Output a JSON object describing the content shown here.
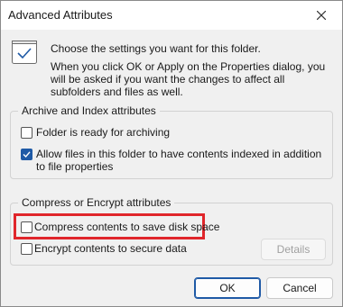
{
  "window": {
    "title": "Advanced Attributes"
  },
  "header": {
    "line1": "Choose the settings you want for this folder.",
    "line2": "When you click OK or Apply on the Properties dialog, you will be asked if you want the changes to affect all subfolders and files as well.",
    "icon": "folder-settings-icon"
  },
  "archive_group": {
    "title": "Archive and Index attributes",
    "options": [
      {
        "label": "Folder is ready for archiving",
        "checked": false
      },
      {
        "label": "Allow files in this folder to have contents indexed in addition to file properties",
        "checked": true
      }
    ]
  },
  "compress_group": {
    "title": "Compress or Encrypt attributes",
    "options": [
      {
        "label": "Compress contents to save disk space",
        "checked": false
      },
      {
        "label": "Encrypt contents to secure data",
        "checked": false
      }
    ],
    "details_label": "Details"
  },
  "buttons": {
    "ok": "OK",
    "cancel": "Cancel"
  },
  "colors": {
    "accent": "#1f5aa6",
    "highlight": "#e0262b"
  }
}
